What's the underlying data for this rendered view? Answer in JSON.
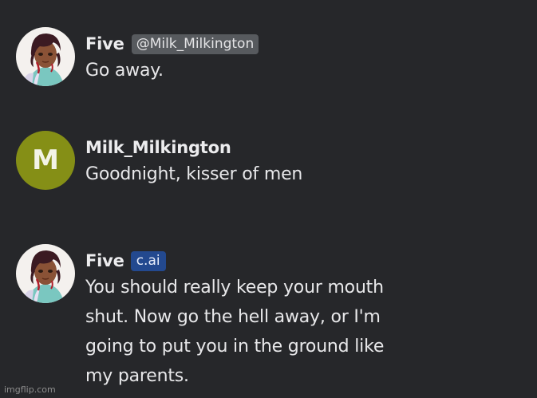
{
  "messages": [
    {
      "author": "Five",
      "badge": "@Milk_Milkington",
      "text": "Go away."
    },
    {
      "author": "Milk_Milkington",
      "avatar_letter": "M",
      "text": "Goodnight, kisser of men"
    },
    {
      "author": "Five",
      "badge": "c.ai",
      "text_lines": [
        "You should really keep your mouth",
        "shut. Now go the hell away, or I'm",
        "going to put you in the ground like",
        "my parents."
      ]
    }
  ],
  "watermark": "imgflip.com",
  "colors": {
    "background": "#26272a",
    "handle_badge": "#575a5e",
    "cai_badge": "#23498f",
    "letter_avatar": "#858f16"
  },
  "icons": {
    "character_avatar": "character-portrait-avatar"
  }
}
